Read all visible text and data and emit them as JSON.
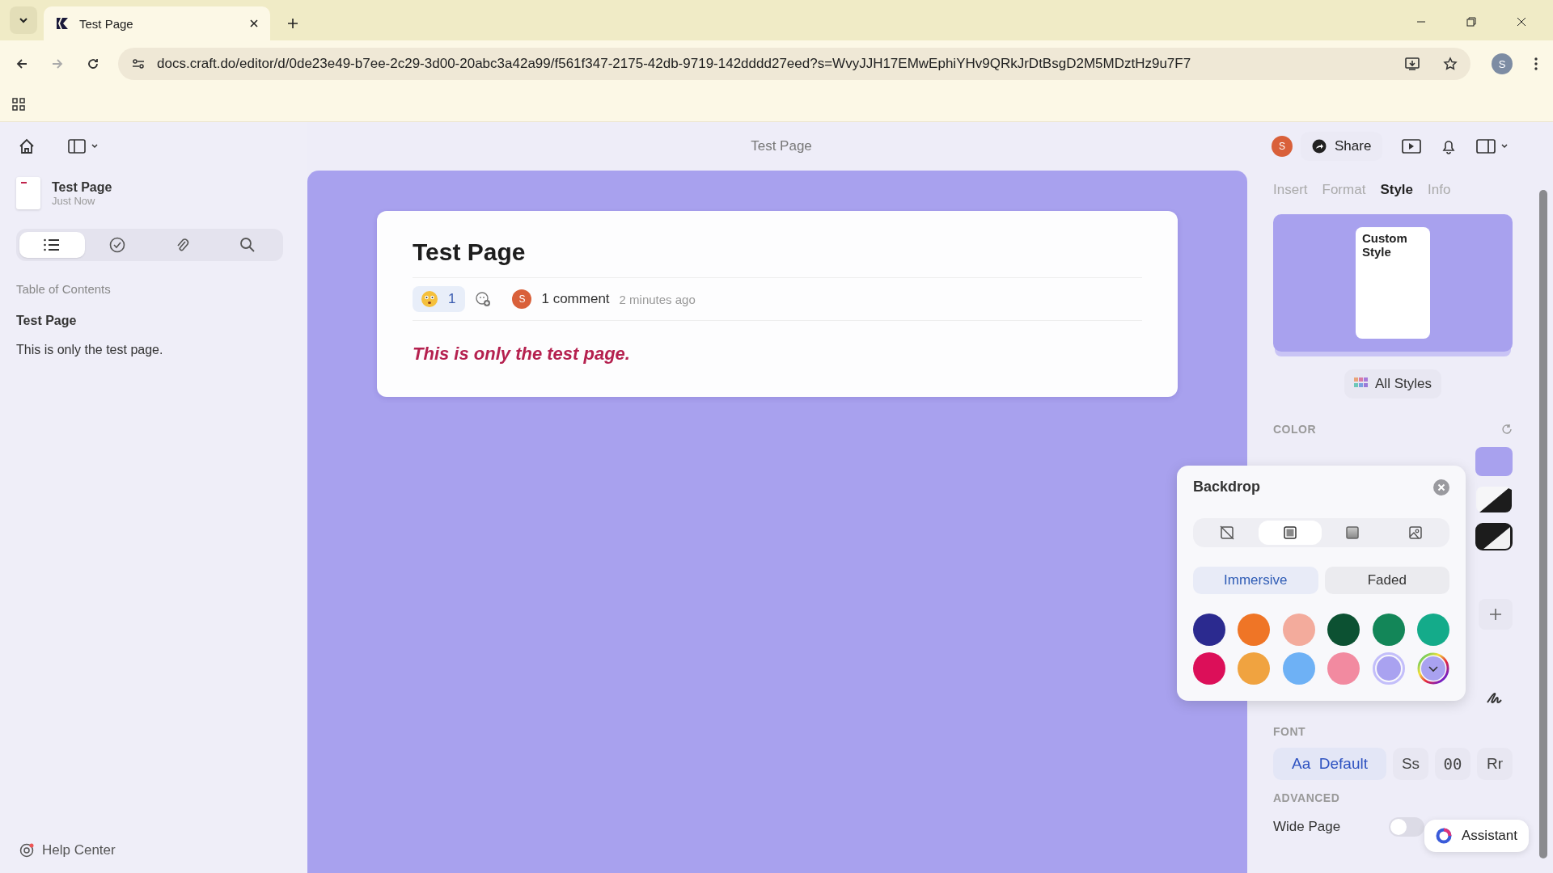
{
  "browser": {
    "tabs": [
      {
        "title": "Test Page",
        "selected": true
      }
    ],
    "url": "docs.craft.do/editor/d/0de23e49-b7ee-2c29-3d00-20abc3a42a99/f561f347-2175-42db-9719-142dddd27eed?s=WvyJJH17EMwEphiYHv9QRkJrDtBsgD2M5MDztHz9u7F7",
    "profile": "S"
  },
  "header": {
    "title": "Test Page",
    "avatar": "S",
    "share": "Share"
  },
  "sidebar": {
    "doc_title": "Test Page",
    "doc_time": "Just Now",
    "tools": [
      {
        "kind": "list",
        "selected": true
      },
      {
        "kind": "tasks",
        "selected": false
      },
      {
        "kind": "attachments",
        "selected": false
      },
      {
        "kind": "search",
        "selected": false
      }
    ],
    "toc_heading": "Table of Contents",
    "toc": [
      {
        "kind": "heading",
        "text": "Test Page"
      },
      {
        "kind": "body",
        "text": "This is only the test page."
      }
    ],
    "help": "Help Center"
  },
  "document": {
    "title": "Test Page",
    "reaction_count": "1",
    "commenter": "S",
    "comments": "1 comment",
    "time": "2 minutes ago",
    "body": "This is only the test page."
  },
  "panel": {
    "tabs": [
      {
        "label": "Insert",
        "selected": false
      },
      {
        "label": "Format",
        "selected": false
      },
      {
        "label": "Style",
        "selected": true
      },
      {
        "label": "Info",
        "selected": false
      }
    ],
    "preview_label": "Custom Style",
    "all_styles": "All Styles",
    "color_label": "COLOR",
    "font_label": "FONT",
    "fonts": [
      {
        "sample": "Aa",
        "label": "Default",
        "selected": true
      },
      {
        "label": "Ss",
        "selected": false
      },
      {
        "label": "00",
        "selected": false
      },
      {
        "label": "Rr",
        "selected": false
      }
    ],
    "advanced_label": "ADVANCED",
    "wide_page": {
      "label": "Wide Page",
      "on": false
    },
    "assistant": "Assistant"
  },
  "backdrop": {
    "title": "Backdrop",
    "modes": [
      {
        "kind": "none",
        "selected": false
      },
      {
        "kind": "solid",
        "selected": true
      },
      {
        "kind": "gradient",
        "selected": false
      },
      {
        "kind": "image",
        "selected": false
      }
    ],
    "styles": [
      {
        "label": "Immersive",
        "selected": true
      },
      {
        "label": "Faded",
        "selected": false
      }
    ],
    "colors": [
      {
        "color": "#2b2a8f",
        "selected": false
      },
      {
        "color": "#ef7526",
        "selected": false
      },
      {
        "color": "#f3ab9c",
        "selected": false
      },
      {
        "color": "#0c5132",
        "selected": false
      },
      {
        "color": "#138658",
        "selected": false
      },
      {
        "color": "#14ab8a",
        "selected": false
      },
      {
        "color": "#dc0f59",
        "selected": false
      },
      {
        "color": "#f0a340",
        "selected": false
      },
      {
        "color": "#6eb1f5",
        "selected": false
      },
      {
        "color": "#f28aa0",
        "selected": false
      },
      {
        "color": "#a9a2f0",
        "selected": true
      }
    ]
  }
}
